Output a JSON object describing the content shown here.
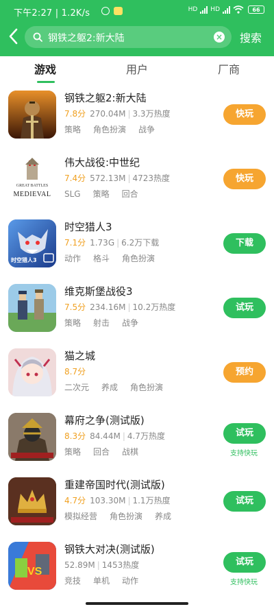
{
  "status_bar": {
    "time": "下午2:27 | 1.2K/s",
    "battery": "66",
    "network": "HD"
  },
  "search": {
    "query": "钢铁之躯2:新大陆",
    "button": "搜索"
  },
  "tabs": [
    {
      "label": "游戏",
      "active": true
    },
    {
      "label": "用户",
      "active": false
    },
    {
      "label": "厂商",
      "active": false
    }
  ],
  "games": [
    {
      "title": "钢铁之躯2:新大陆",
      "score": "7.8分",
      "size": "270.04M",
      "stat": "3.3万热度",
      "tags": [
        "策略",
        "角色扮演",
        "战争"
      ],
      "button": "快玩",
      "button_color": "#f6a530",
      "note": "",
      "icon": "knight-game-icon",
      "thumb_bg": "#7a3a18"
    },
    {
      "title": "伟大战役:中世纪",
      "score": "7.4分",
      "size": "572.13M",
      "stat": "4723热度",
      "tags": [
        "SLG",
        "策略",
        "回合"
      ],
      "button": "快玩",
      "button_color": "#f6a530",
      "note": "",
      "icon": "great-battles-icon",
      "thumb_bg": "#ffffff",
      "logo_lines": [
        "GREAT BATTLES",
        "MEDIEVAL"
      ]
    },
    {
      "title": "时空猎人3",
      "score": "7.1分",
      "size": "1.73G",
      "stat": "6.2万下载",
      "tags": [
        "动作",
        "格斗",
        "角色扮演"
      ],
      "button": "下载",
      "button_color": "#2fbf5e",
      "note": "",
      "icon": "werewolf-game-icon",
      "thumb_bg": "#2a5fb8",
      "logo_lines": [
        "时空猎人3"
      ]
    },
    {
      "title": "维克斯堡战役3",
      "score": "7.5分",
      "size": "234.16M",
      "stat": "10.2万热度",
      "tags": [
        "策略",
        "射击",
        "战争"
      ],
      "button": "试玩",
      "button_color": "#2fbf5e",
      "note": "",
      "icon": "soldiers-game-icon",
      "thumb_bg": "#8fc4e8"
    },
    {
      "title": "猫之城",
      "score": "8.7分",
      "size": "",
      "stat": "",
      "tags": [
        "二次元",
        "养成",
        "角色扮演"
      ],
      "button": "预约",
      "button_color": "#f6a530",
      "note": "",
      "icon": "anime-girl-icon",
      "thumb_bg": "#f2d6d6"
    },
    {
      "title": "幕府之争(测试版)",
      "score": "8.3分",
      "size": "84.44M",
      "stat": "4.7万热度",
      "tags": [
        "策略",
        "回合",
        "战棋"
      ],
      "button": "试玩",
      "button_color": "#2fbf5e",
      "note": "支持快玩",
      "icon": "samurai-game-icon",
      "thumb_bg": "#6a5a4a"
    },
    {
      "title": "重建帝国时代(测试版)",
      "score": "4.7分",
      "size": "103.30M",
      "stat": "1.1万热度",
      "tags": [
        "模拟经营",
        "角色扮演",
        "养成"
      ],
      "button": "试玩",
      "button_color": "#2fbf5e",
      "note": "",
      "icon": "empire-crown-icon",
      "thumb_bg": "#4a2a1a"
    },
    {
      "title": "钢铁大对决(测试版)",
      "score": "",
      "size": "52.89M",
      "stat": "1453热度",
      "tags": [
        "竞技",
        "单机",
        "动作"
      ],
      "button": "试玩",
      "button_color": "#2fbf5e",
      "note": "支持快玩",
      "icon": "robot-vs-icon",
      "thumb_bg": "#3a6ac8"
    }
  ]
}
